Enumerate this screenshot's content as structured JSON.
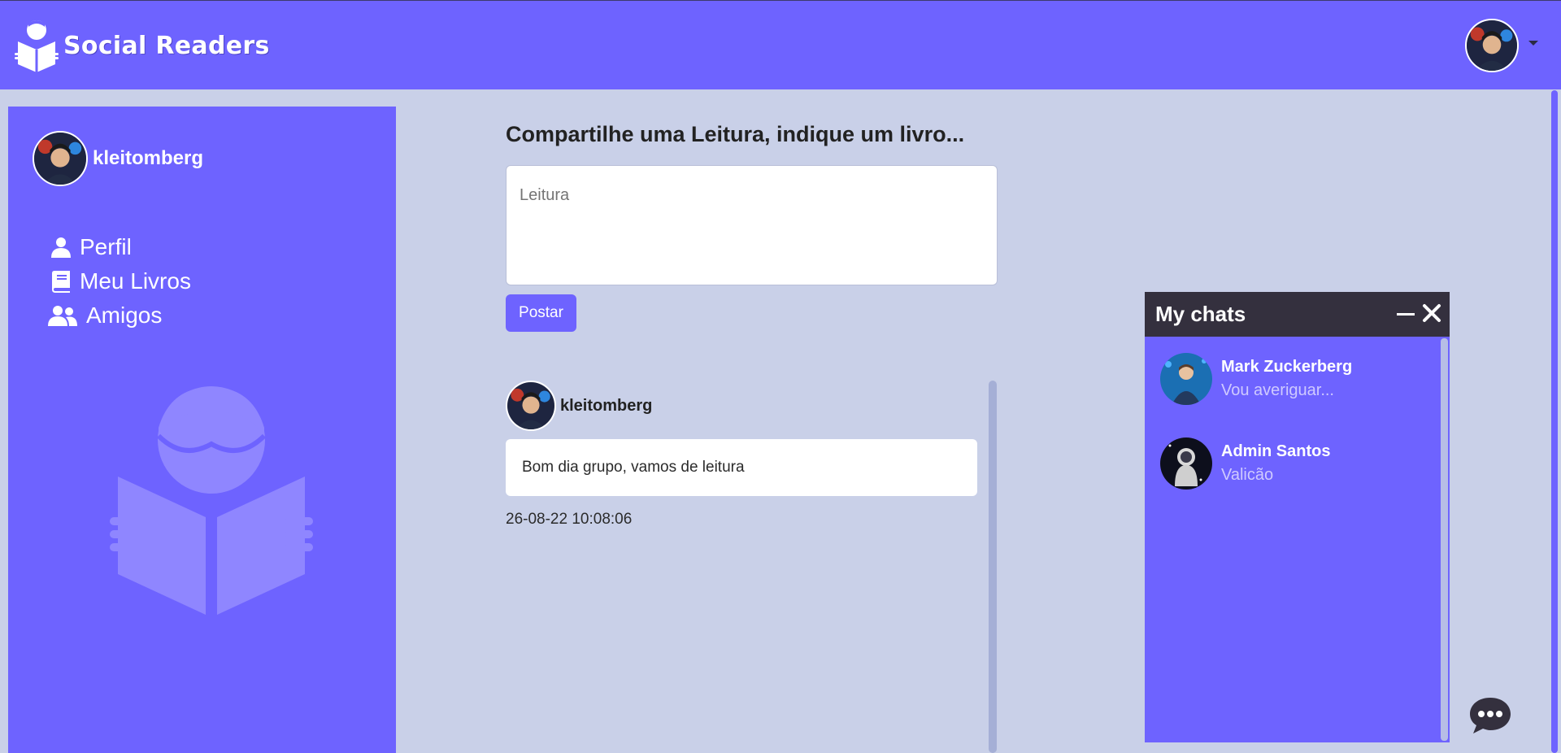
{
  "header": {
    "brand": "Social Readers",
    "user_menu_icon": "caret-down-icon"
  },
  "sidebar": {
    "username": "kleitomberg",
    "items": [
      {
        "label": "Perfil",
        "icon": "user-icon"
      },
      {
        "label": "Meu Livros",
        "icon": "book-icon"
      },
      {
        "label": "Amigos",
        "icon": "users-icon"
      }
    ],
    "illustration": "reader-with-book-illustration"
  },
  "composer": {
    "title": "Compartilhe uma Leitura, indique um livro...",
    "placeholder": "Leitura",
    "post_label": "Postar"
  },
  "feed": {
    "posts": [
      {
        "user": "kleitomberg",
        "text": "Bom dia grupo, vamos de leitura",
        "time": "26-08-22 10:08:06"
      }
    ]
  },
  "chat": {
    "title": "My chats",
    "conversations": [
      {
        "name": "Mark Zuckerberg",
        "last_message": "Vou averiguar..."
      },
      {
        "name": "Admin Santos",
        "last_message": "Valicão"
      }
    ]
  },
  "colors": {
    "primary": "#6e63ff",
    "background": "#c9d0e8",
    "chat_header": "#34303e"
  }
}
